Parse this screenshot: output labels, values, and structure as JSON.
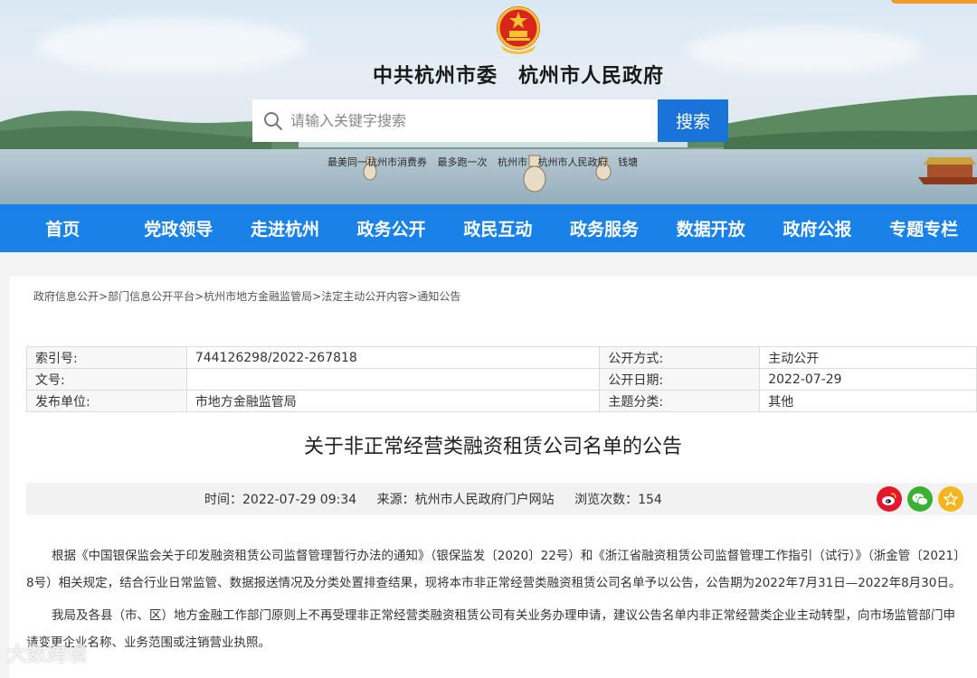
{
  "site": {
    "title": "中共杭州市委　杭州市人民政府"
  },
  "search": {
    "placeholder": "请输入关键字搜索",
    "button_label": "搜索"
  },
  "hot_links": [
    "最美同一杭州市消费券",
    "最多跑一次",
    "杭州市",
    "杭州市人民政府",
    "钱塘"
  ],
  "nav": [
    "首页",
    "党政领导",
    "走进杭州",
    "政务公开",
    "政民互动",
    "政务服务",
    "数据开放",
    "政府公报",
    "专题专栏"
  ],
  "breadcrumb": [
    "政府信息公开",
    "部门信息公开平台",
    "杭州市地方金融监管局",
    "法定主动公开内容",
    "通知公告"
  ],
  "breadcrumb_sep": ">",
  "meta": {
    "index_label": "索引号:",
    "index_value": "744126298/2022-267818",
    "disclose_label": "公开方式:",
    "disclose_value": "主动公开",
    "doc_label": "文号:",
    "doc_value": "",
    "date_label": "公开日期:",
    "date_value": "2022-07-29",
    "publisher_label": "发布单位:",
    "publisher_value": "市地方金融监管局",
    "topic_label": "主题分类:",
    "topic_value": "其他"
  },
  "article": {
    "title": "关于非正常经营类融资租赁公司名单的公告",
    "time": "时间：2022-07-29 09:34",
    "source": "来源：杭州市人民政府门户网站",
    "views": "浏览次数：154",
    "paragraphs": [
      "根据《中国银保监会关于印发融资租赁公司监督管理暂行办法的通知》（银保监发〔2020〕22号）和《浙江省融资租赁公司监督管理工作指引（试行）》（浙金管〔2021〕8号）相关规定，结合行业日常监管、数据报送情况及分类处置排查结果，现将本市非正常经营类融资租赁公司名单予以公告，公告期为2022年7月31日—2022年8月30日。",
      "我局及各县（市、区）地方金融工作部门原则上不再受理非正常经营类融资租赁公司有关业务办理申请，建议公告名单内非正常经营类企业主动转型，向市场监管部门申请变更企业名称、业务范围或注销营业执照。"
    ]
  },
  "share": [
    "weibo-icon",
    "wechat-icon",
    "favorite-icon"
  ],
  "watermark": "大数跨境",
  "colors": {
    "nav_bg": "#1981e8",
    "search_btn": "#1a73d9",
    "weibo": "#e6162d",
    "wechat": "#3cb034",
    "favorite": "#f5b51f"
  }
}
